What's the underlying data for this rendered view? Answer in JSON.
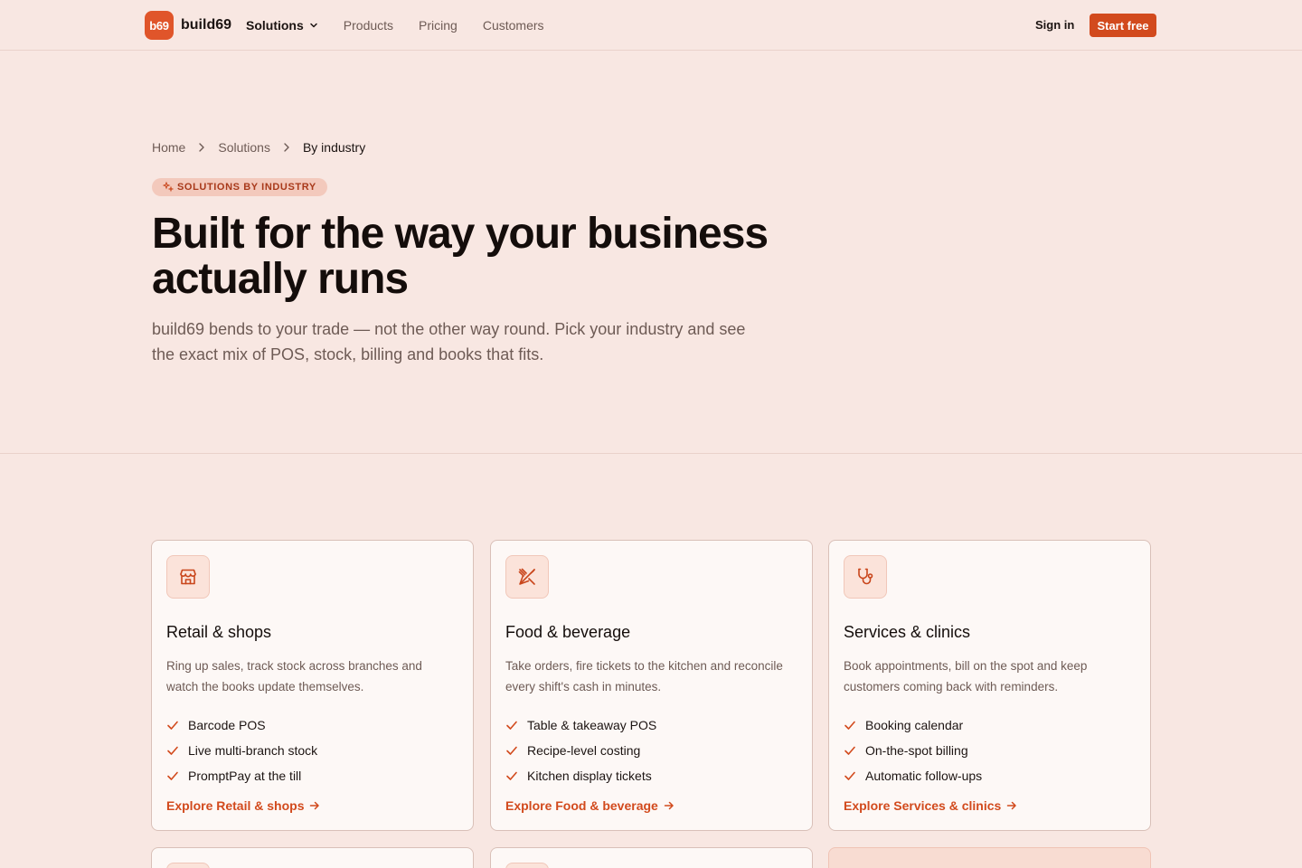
{
  "nav": {
    "logo_badge": "b69",
    "logo_text": "build69",
    "links": [
      {
        "label": "Solutions"
      },
      {
        "label": "Products"
      },
      {
        "label": "Pricing"
      },
      {
        "label": "Customers"
      }
    ],
    "sign_in": "Sign in",
    "start": "Start free"
  },
  "breadcrumb": [
    "Home",
    "Solutions",
    "By industry"
  ],
  "hero": {
    "eyebrow": "SOLUTIONS BY INDUSTRY",
    "title": "Built for the way your business actually runs",
    "subtitle": "build69 bends to your trade — not the other way round. Pick your industry and see the exact mix of POS, stock, billing and books that fits."
  },
  "cards": [
    {
      "icon": "store-icon",
      "title": "Retail & shops",
      "desc": "Ring up sales, track stock across branches and watch the books update themselves.",
      "features": [
        "Barcode POS",
        "Live multi-branch stock",
        "PromptPay at the till"
      ],
      "link": "Explore Retail & shops"
    },
    {
      "icon": "utensils-icon",
      "title": "Food & beverage",
      "desc": "Take orders, fire tickets to the kitchen and reconcile every shift's cash in minutes.",
      "features": [
        "Table & takeaway POS",
        "Recipe-level costing",
        "Kitchen display tickets"
      ],
      "link": "Explore Food & beverage"
    },
    {
      "icon": "stethoscope-icon",
      "title": "Services & clinics",
      "desc": "Book appointments, bill on the spot and keep customers coming back with reminders.",
      "features": [
        "Booking calendar",
        "On-the-spot billing",
        "Automatic follow-ups"
      ],
      "link": "Explore Services & clinics"
    }
  ],
  "colors": {
    "accent": "#d24a1d",
    "background": "#f8e7e2",
    "card": "#fdf8f6"
  }
}
